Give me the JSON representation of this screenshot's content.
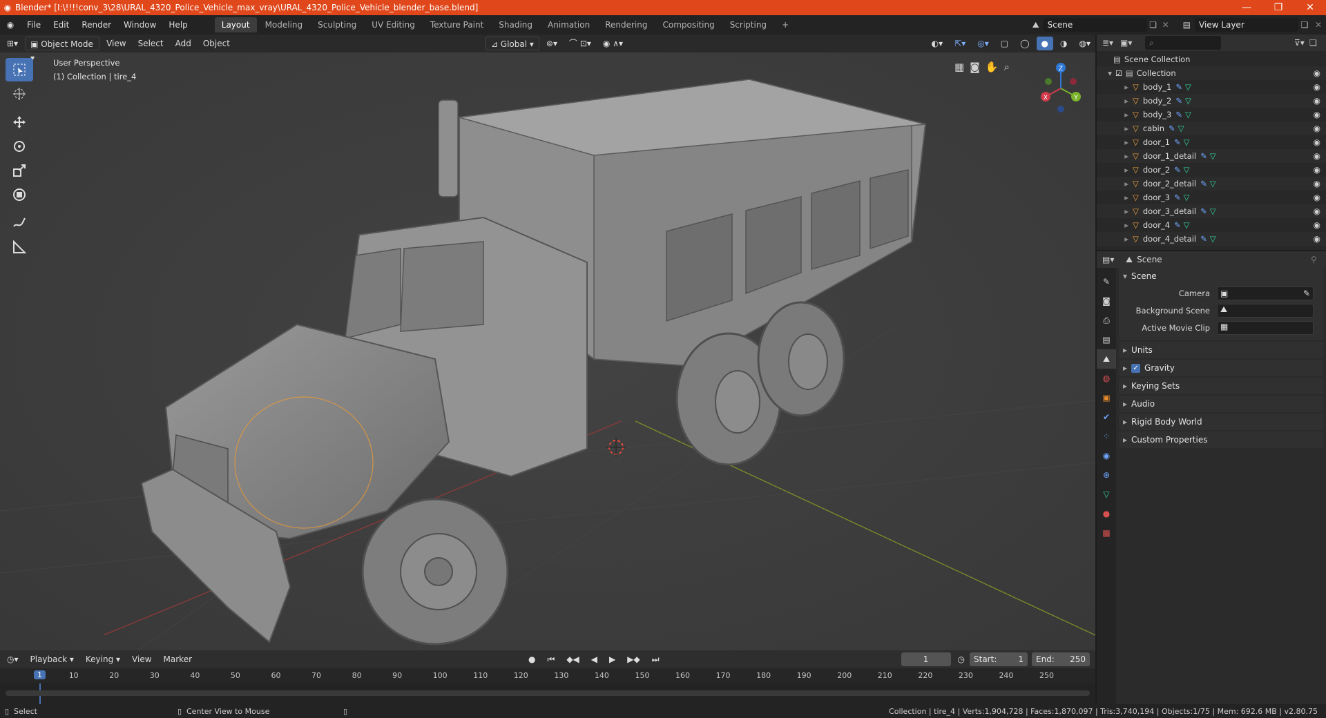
{
  "window": {
    "title": "Blender* [I:\\!!!!conv_3\\28\\URAL_4320_Police_Vehicle_max_vray\\URAL_4320_Police_Vehicle_blender_base.blend]",
    "minimize": "—",
    "maximize": "❐",
    "close": "✕"
  },
  "topbar": {
    "menus": [
      "File",
      "Edit",
      "Render",
      "Window",
      "Help"
    ],
    "workspaces": [
      "Layout",
      "Modeling",
      "Sculpting",
      "UV Editing",
      "Texture Paint",
      "Shading",
      "Animation",
      "Rendering",
      "Compositing",
      "Scripting"
    ],
    "active_workspace": "Layout",
    "add_workspace": "+",
    "scene": "Scene",
    "view_layer": "View Layer"
  },
  "viewport": {
    "mode": "Object Mode",
    "menus": [
      "View",
      "Select",
      "Add",
      "Object"
    ],
    "transform_orientation": "Global",
    "perspective_label": "User Perspective",
    "collection_label": "(1) Collection | tire_4",
    "gizmo": {
      "x": "X",
      "y": "Y",
      "z": "Z"
    }
  },
  "outliner": {
    "root": "Scene Collection",
    "collection": "Collection",
    "items": [
      "body_1",
      "body_2",
      "body_3",
      "cabin",
      "door_1",
      "door_1_detail",
      "door_2",
      "door_2_detail",
      "door_3",
      "door_3_detail",
      "door_4",
      "door_4_detail"
    ]
  },
  "properties": {
    "header": "Scene",
    "panel_title": "Scene",
    "camera_label": "Camera",
    "background_scene_label": "Background Scene",
    "active_movie_clip_label": "Active Movie Clip",
    "sections": [
      "Units",
      "Gravity",
      "Keying Sets",
      "Audio",
      "Rigid Body World",
      "Custom Properties"
    ],
    "gravity_enabled": true
  },
  "timeline": {
    "menus": [
      "Playback",
      "Keying",
      "View",
      "Marker"
    ],
    "current_frame": "1",
    "start_label": "Start:",
    "start": "1",
    "end_label": "End:",
    "end": "250",
    "ticks": [
      "1",
      "10",
      "20",
      "30",
      "40",
      "50",
      "60",
      "70",
      "80",
      "90",
      "100",
      "110",
      "120",
      "130",
      "140",
      "150",
      "160",
      "170",
      "180",
      "190",
      "200",
      "210",
      "220",
      "230",
      "240",
      "250"
    ]
  },
  "statusbar": {
    "select": "Select",
    "center_view": "Center View to Mouse",
    "stats": "Collection | tire_4 | Verts:1,904,728 | Faces:1,870,097 | Tris:3,740,194 | Objects:1/75 | Mem: 692.6 MB | v2.80.75"
  }
}
